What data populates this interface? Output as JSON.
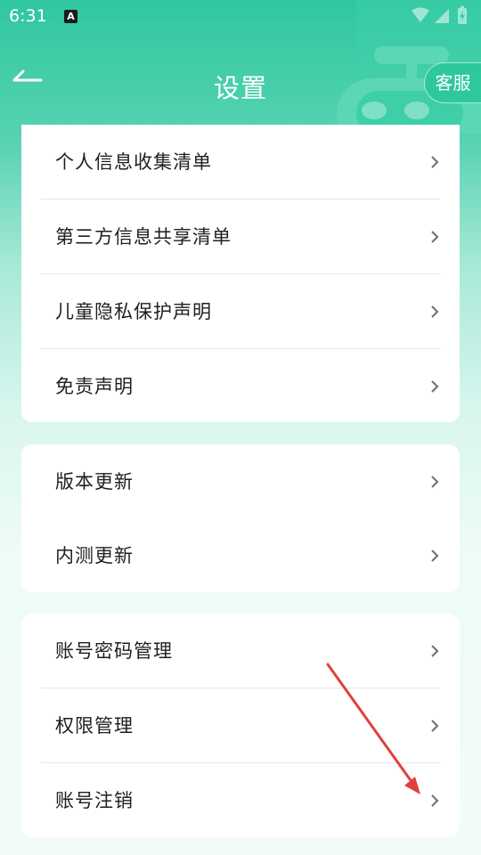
{
  "status_bar": {
    "time": "6:31",
    "notification_icon": "a-letter-icon"
  },
  "header": {
    "title": "设置",
    "support_label": "客服"
  },
  "sections": [
    {
      "items": [
        {
          "label": "个人信息收集清单"
        },
        {
          "label": "第三方信息共享清单"
        },
        {
          "label": "儿童隐私保护声明"
        },
        {
          "label": "免责声明"
        }
      ]
    },
    {
      "items": [
        {
          "label": "版本更新"
        },
        {
          "label": "内测更新"
        }
      ]
    },
    {
      "items": [
        {
          "label": "账号密码管理"
        },
        {
          "label": "权限管理"
        },
        {
          "label": "账号注销"
        }
      ]
    }
  ],
  "colors": {
    "accent": "#2fc7a0",
    "annotation": "#e0403a"
  }
}
